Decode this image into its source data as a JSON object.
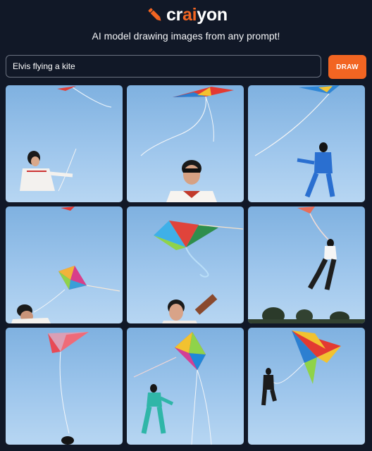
{
  "header": {
    "logo": {
      "prefix": "cr",
      "accent": "ai",
      "suffix": "yon",
      "icon": "pencil-icon"
    },
    "tagline": "AI model drawing images from any prompt!"
  },
  "prompt": {
    "value": "Elvis flying a kite"
  },
  "draw_button": {
    "label": "DRAW"
  },
  "colors": {
    "background": "#111827",
    "accent": "#f26522",
    "input_border": "#6b7280",
    "sky": "#9ec6ec"
  },
  "results": [
    {
      "description": "generated-image-1"
    },
    {
      "description": "generated-image-2"
    },
    {
      "description": "generated-image-3"
    },
    {
      "description": "generated-image-4"
    },
    {
      "description": "generated-image-5"
    },
    {
      "description": "generated-image-6"
    },
    {
      "description": "generated-image-7"
    },
    {
      "description": "generated-image-8"
    },
    {
      "description": "generated-image-9"
    }
  ]
}
